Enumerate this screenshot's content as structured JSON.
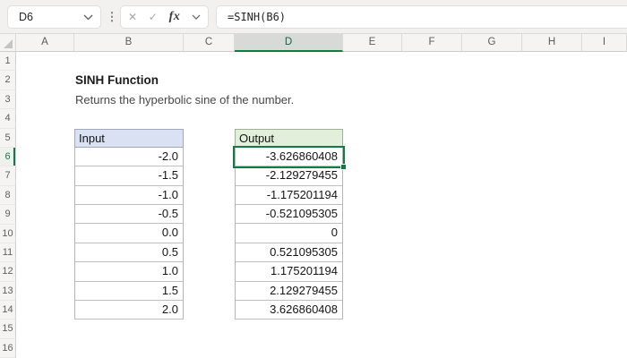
{
  "formula_bar": {
    "name_box_value": "D6",
    "more_icon": "⋮",
    "cancel_icon": "✕",
    "enter_icon": "✓",
    "fx_label": "fx",
    "formula": "=SINH(B6)"
  },
  "sheet": {
    "columns": [
      "A",
      "B",
      "C",
      "D",
      "E",
      "F",
      "G",
      "H",
      "I"
    ],
    "rows": [
      "1",
      "2",
      "3",
      "4",
      "5",
      "6",
      "7",
      "8",
      "9",
      "10",
      "11",
      "12",
      "13",
      "14",
      "15",
      "16"
    ],
    "selected_column": "D",
    "selected_row": "6",
    "title": "SINH Function",
    "subtitle": "Returns the hyperbolic sine of the number.",
    "input_table": {
      "header": "Input",
      "values": [
        "-2.0",
        "-1.5",
        "-1.0",
        "-0.5",
        "0.0",
        "0.5",
        "1.0",
        "1.5",
        "2.0"
      ]
    },
    "output_table": {
      "header": "Output",
      "values": [
        "-3.626860408",
        "-2.129279455",
        "-1.175201194",
        "-0.521095305",
        "0",
        "0.521095305",
        "1.175201194",
        "2.129279455",
        "3.626860408"
      ]
    }
  },
  "colors": {
    "accent_green": "#107C41",
    "input_header_fill": "#D9E1F2",
    "output_header_fill": "#E2EFDA"
  }
}
